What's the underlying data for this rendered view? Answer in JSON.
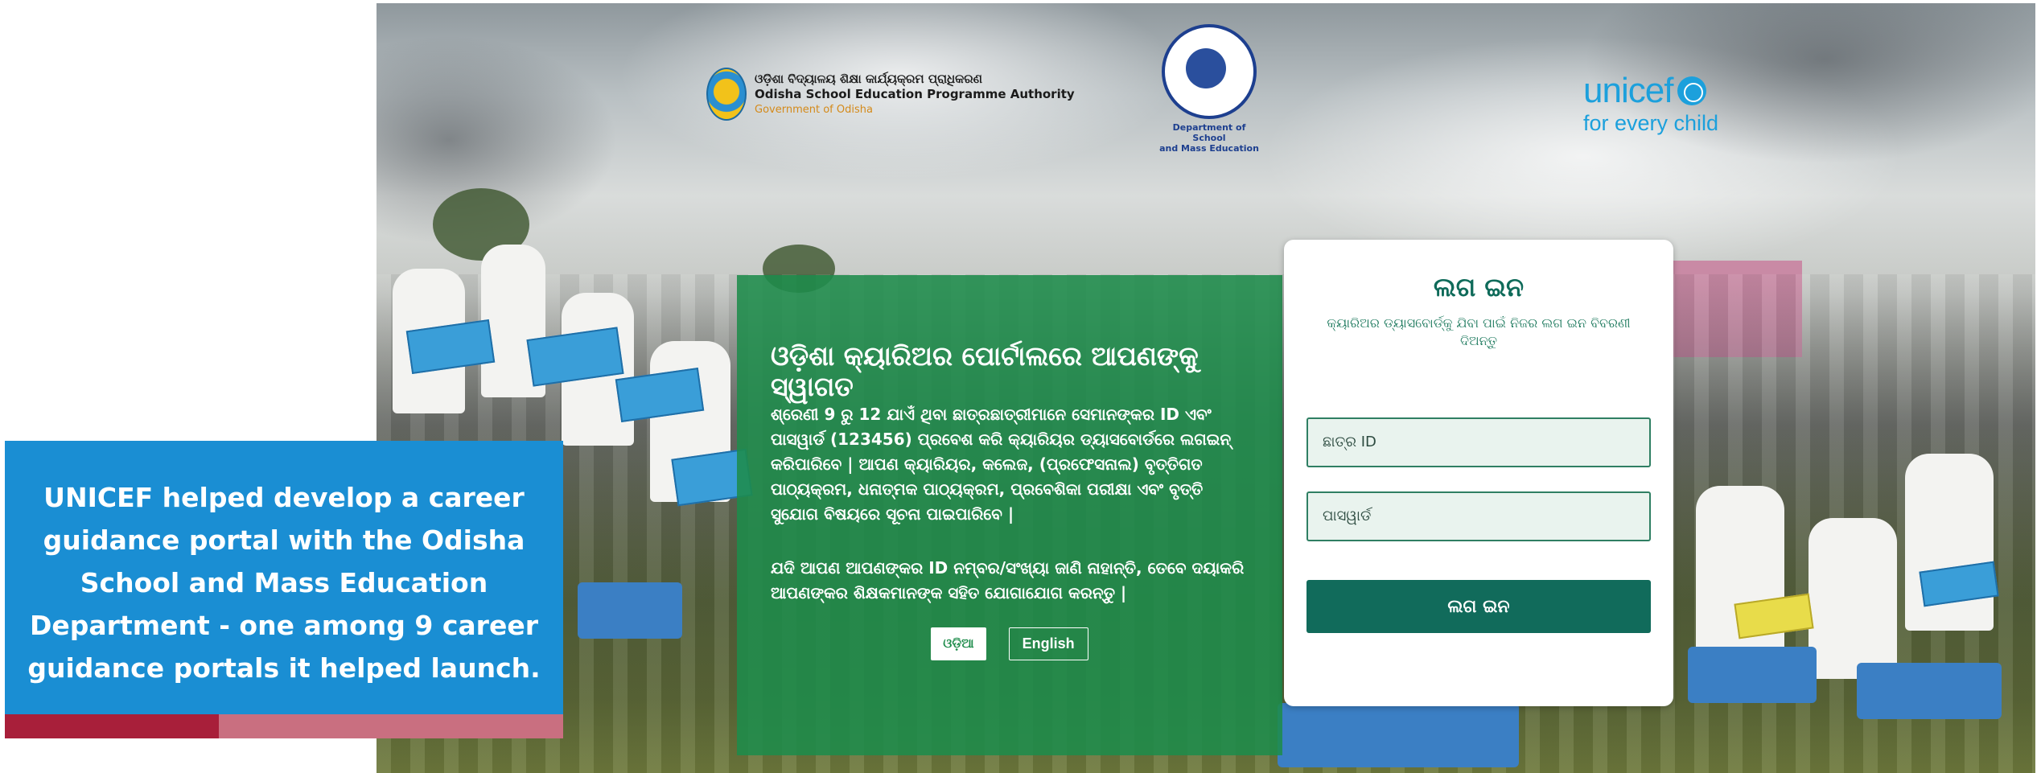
{
  "logos": {
    "osepa_odia": "ଓଡ଼ିଶା ବିଦ୍ୟାଳୟ ଶିକ୍ଷା କାର୍ଯ୍ୟକ୍ରମ ପ୍ରାଧିକରଣ",
    "osepa_english": "Odisha School Education Programme Authority",
    "osepa_gov": "Government of Odisha",
    "dept_line1": "Department of School",
    "dept_line2": "and Mass Education",
    "unicef_word": "unicef",
    "unicef_tagline": "for every child"
  },
  "welcome": {
    "title": "ଓଡ଼ିଶା କ୍ୟାରିଅର ପୋର୍ଟାଲରେ ଆପଣଙ୍କୁ ସ୍ୱାଗତ",
    "paragraph1": "ଶ୍ରେଣୀ 9 ରୁ 12 ଯାଏଁ ଥିବା ଛାତ୍ରଛାତ୍ରୀମାନେ ସେମାନଙ୍କର ID ଏବଂ ପାସୱାର୍ଡ (123456) ପ୍ରବେଶ କରି କ୍ୟାରିୟର ଡ୍ୟାସବୋର୍ଡରେ ଲଗଇନ୍ କରିପାରିବେ | ଆପଣ କ୍ୟାରିୟର, କଲେଜ, (ପ୍ରଫେସନାଲ) ବୃତ୍ତିଗତ ପାଠ୍ୟକ୍ରମ, ଧନାତ୍ମକ ପାଠ୍ୟକ୍ରମ, ପ୍ରବେଶିକା ପରୀକ୍ଷା ଏବଂ ବୃତ୍ତି ସୁଯୋଗ ବିଷୟରେ ସୂଚନା ପାଇପାରିବେ |",
    "paragraph2": "ଯଦି ଆପଣ ଆପଣଙ୍କର ID ନମ୍ବର/ସଂଖ୍ୟା ଜାଣି ନାହାନ୍ତି, ତେବେ ଦୟାକରି ଆପଣଙ୍କର ଶିକ୍ଷକମାନଙ୍କ ସହିତ ଯୋଗାଯୋଗ କରନ୍ତୁ |",
    "lang_odia": "ଓଡ଼ିଆ",
    "lang_english": "English"
  },
  "login": {
    "title": "ଲଗ ଇନ",
    "subtitle": "କ୍ୟାରିଅର ଡ୍ୟାସବୋର୍ଡ୍‌କୁ ଯିବା ପାଇଁ ନିଜର ଲଗ ଇନ ବିବରଣୀ ଦିଅନ୍ତୁ",
    "student_id_placeholder": "ଛାତ୍ର ID",
    "password_placeholder": "ପାସୱାର୍ଡ",
    "button": "ଲଗ ଇନ"
  },
  "caption": {
    "text": "UNICEF helped develop a career guidance portal with the Odisha School and Mass Education Department - one among 9 career guidance portals it helped launch."
  },
  "colors": {
    "caption_bg": "#1a8ed3",
    "welcome_bg": "#1e8c4b",
    "login_button": "#116b5b",
    "unicef_blue": "#1ca0dc",
    "bar_dark": "#a81f3a",
    "bar_light": "#c96f80"
  }
}
